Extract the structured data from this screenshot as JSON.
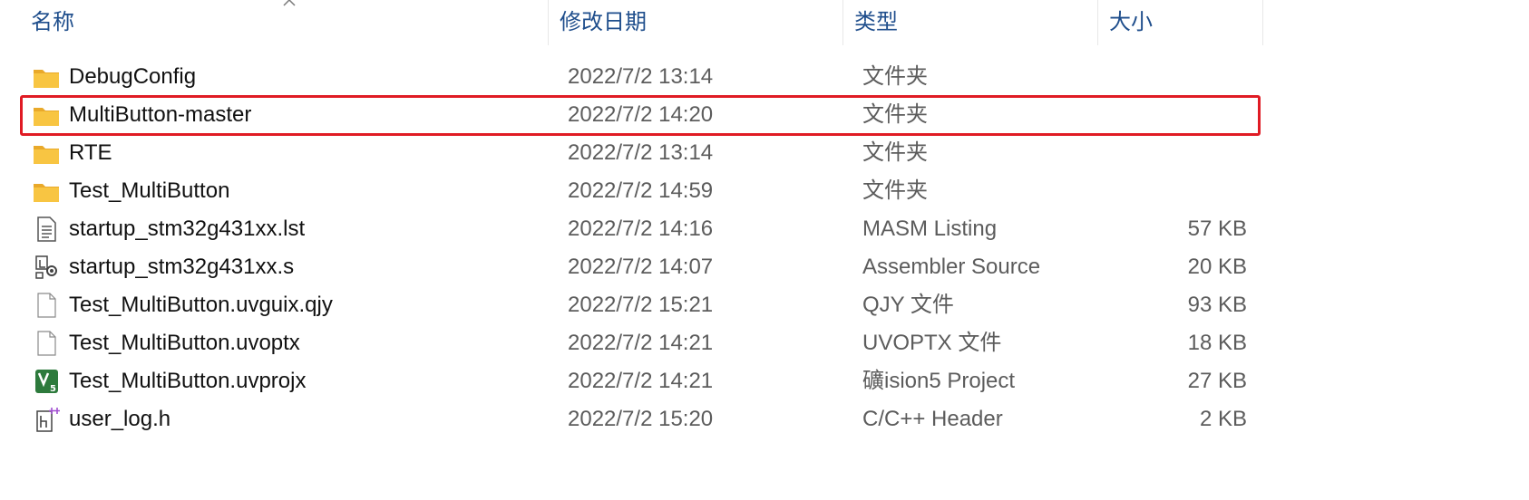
{
  "columns": {
    "name": "名称",
    "date": "修改日期",
    "type": "类型",
    "size": "大小"
  },
  "rows": [
    {
      "name": "DebugConfig",
      "date": "2022/7/2 13:14",
      "type": "文件夹",
      "size": "",
      "icon": "folder-icon"
    },
    {
      "name": "MultiButton-master",
      "date": "2022/7/2 14:20",
      "type": "文件夹",
      "size": "",
      "icon": "folder-icon",
      "highlighted": true
    },
    {
      "name": "RTE",
      "date": "2022/7/2 13:14",
      "type": "文件夹",
      "size": "",
      "icon": "folder-icon"
    },
    {
      "name": "Test_MultiButton",
      "date": "2022/7/2 14:59",
      "type": "文件夹",
      "size": "",
      "icon": "folder-icon"
    },
    {
      "name": "startup_stm32g431xx.lst",
      "date": "2022/7/2 14:16",
      "type": "MASM Listing",
      "size": "57 KB",
      "icon": "text-file-icon"
    },
    {
      "name": "startup_stm32g431xx.s",
      "date": "2022/7/2 14:07",
      "type": "Assembler Source",
      "size": "20 KB",
      "icon": "assembler-file-icon"
    },
    {
      "name": "Test_MultiButton.uvguix.qjy",
      "date": "2022/7/2 15:21",
      "type": "QJY 文件",
      "size": "93 KB",
      "icon": "blank-file-icon"
    },
    {
      "name": "Test_MultiButton.uvoptx",
      "date": "2022/7/2 14:21",
      "type": "UVOPTX 文件",
      "size": "18 KB",
      "icon": "blank-file-icon"
    },
    {
      "name": "Test_MultiButton.uvprojx",
      "date": "2022/7/2 14:21",
      "type": "礦ision5 Project",
      "size": "27 KB",
      "icon": "keil-project-icon"
    },
    {
      "name": "user_log.h",
      "date": "2022/7/2 15:20",
      "type": "C/C++ Header",
      "size": "2 KB",
      "icon": "header-file-icon"
    }
  ],
  "colors": {
    "header_text": "#1f4e8c",
    "highlight_border": "#e01b24",
    "folder": "#f8c542"
  }
}
